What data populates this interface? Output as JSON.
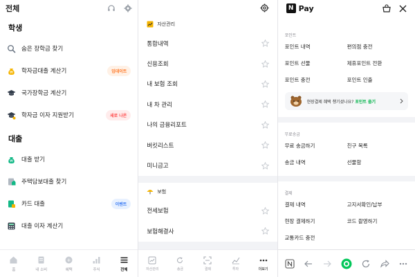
{
  "panel1": {
    "title": "전체",
    "sections": [
      {
        "title": "학생",
        "items": [
          {
            "label": "숨은 장학금 찾기",
            "icon": "search-icon",
            "badge": ""
          },
          {
            "label": "학자금대출 계산기",
            "icon": "money-bag-icon",
            "badge": "업데이트",
            "badge_style": "orange"
          },
          {
            "label": "국가장학금 계산기",
            "icon": "graduation-cap-icon",
            "badge": ""
          },
          {
            "label": "학자금 이자 지원받기",
            "icon": "graduation-cap-icon",
            "badge": "새로 나온",
            "badge_style": "red"
          }
        ]
      },
      {
        "title": "대출",
        "items": [
          {
            "label": "대출 받기",
            "icon": "money-bag-icon",
            "badge": ""
          },
          {
            "label": "주택담보대출 찾기",
            "icon": "house-document-icon",
            "badge": ""
          },
          {
            "label": "카드 대출",
            "icon": "card-document-icon",
            "badge": "이벤트",
            "badge_style": "blue"
          },
          {
            "label": "대출 이자 계산기",
            "icon": "calculator-icon",
            "badge": ""
          }
        ]
      }
    ],
    "nav": [
      {
        "label": "홈",
        "icon": "home-icon",
        "active": false
      },
      {
        "label": "내 소비",
        "icon": "receipt-icon",
        "active": false
      },
      {
        "label": "혜택",
        "icon": "benefit-icon",
        "active": false
      },
      {
        "label": "주식",
        "icon": "stock-chart-icon",
        "active": false
      },
      {
        "label": "전체",
        "icon": "menu-icon",
        "active": true
      }
    ]
  },
  "panel2": {
    "groups": [
      {
        "title": "자산관리",
        "icon": "asset-chart-icon",
        "items": [
          "통합내역",
          "신용조회",
          "내 보험 조회",
          "내 차 관리",
          "나의 금융리포트",
          "버킷리스트",
          "미니금고"
        ]
      },
      {
        "title": "보험",
        "icon": "umbrella-icon",
        "items": [
          "전세보험",
          "보험해결사"
        ]
      }
    ],
    "nav": [
      {
        "label": "자산관리",
        "icon": "asset-chart-icon",
        "active": false
      },
      {
        "label": "송금",
        "icon": "refresh-icon",
        "active": false
      },
      {
        "label": "결제",
        "icon": "scan-icon",
        "active": false
      },
      {
        "label": "투자",
        "icon": "stock-chart-icon",
        "active": false
      },
      {
        "label": "더보기",
        "icon": "more-dots-icon",
        "active": true
      }
    ]
  },
  "panel3": {
    "logo_letter": "N",
    "logo_text": "Pay",
    "sections": [
      {
        "title": "포인트",
        "items": [
          "포인트 내역",
          "편의점 충전",
          "포인트 선물",
          "제휴포인트 전환",
          "포인트 충전",
          "포인트 인출"
        ]
      },
      {
        "title": "무료송금",
        "items": [
          "무료 송금하기",
          "친구 목록",
          "송금 내역",
          "선물함"
        ]
      },
      {
        "title": "결제",
        "items": [
          "결제 내역",
          "고지서확인/납부",
          "현장 결제하기",
          "코드 촬영하기",
          "교통카드 충전"
        ]
      }
    ],
    "promo": {
      "text": "현장결제 혜택 챙기셨나요?",
      "link": "포인트 줍기"
    },
    "browser": [
      "n-icon",
      "back-arrow-icon",
      "forward-arrow-icon",
      "green-dot-icon",
      "reload-icon",
      "share-icon",
      "more-dots-icon"
    ]
  },
  "colors": {
    "accent_green": "#03c75a",
    "badge_orange": "#ff7a2a",
    "badge_red": "#ff4b4b",
    "badge_blue": "#3f7ff4"
  }
}
